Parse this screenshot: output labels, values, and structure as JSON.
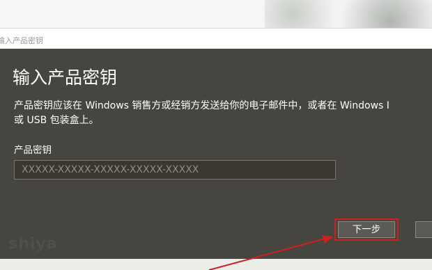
{
  "window": {
    "title": "输入产品密钥"
  },
  "dialog": {
    "heading": "输入产品密钥",
    "description_line1": "产品密钥应该在 Windows 销售方或经销方发送给你的电子邮件中，或者在 Windows I",
    "description_line2": "或 USB 包装盒上。",
    "field_label": "产品密钥",
    "key_placeholder": "XXXXX-XXXXX-XXXXX-XXXXX-XXXXX",
    "key_value": "",
    "next_label": "下一步",
    "cancel_label": ""
  },
  "annotation": {
    "highlight_color": "#cf1f1f"
  },
  "colors": {
    "dialog_bg": "#47453f",
    "input_bg": "#39372f",
    "button_bg": "#5b5a55"
  }
}
